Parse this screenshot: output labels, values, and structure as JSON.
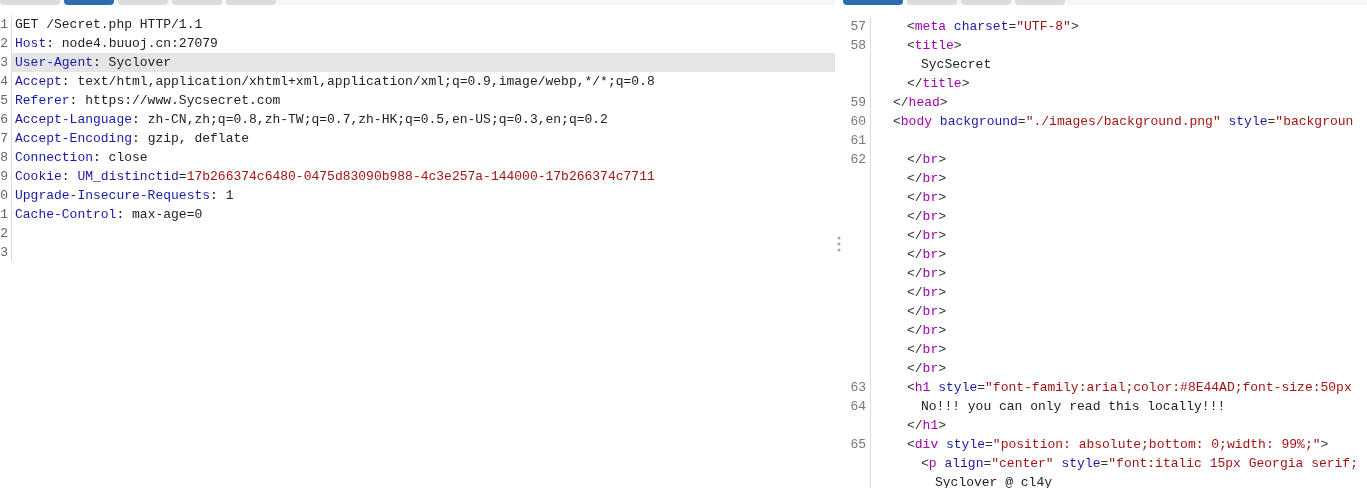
{
  "request_tabs": [
    {
      "selected": false
    },
    {
      "selected": true
    },
    {
      "selected": false
    },
    {
      "selected": false
    },
    {
      "selected": false
    }
  ],
  "response_tabs": [
    {
      "selected": true
    },
    {
      "selected": false
    },
    {
      "selected": false
    },
    {
      "selected": false
    }
  ],
  "request_lines": [
    {
      "number": "1",
      "selected": false,
      "tokens": [
        {
          "kind": "text",
          "text": "GET /Secret.php HTTP/1.1"
        }
      ]
    },
    {
      "number": "2",
      "selected": false,
      "tokens": [
        {
          "kind": "name",
          "text": "Host"
        },
        {
          "kind": "text",
          "text": ": node4.buuoj.cn:27079"
        }
      ]
    },
    {
      "number": "3",
      "selected": true,
      "tokens": [
        {
          "kind": "name",
          "text": "User-Agent"
        },
        {
          "kind": "text",
          "text": ": Syclover"
        }
      ]
    },
    {
      "number": "4",
      "selected": false,
      "tokens": [
        {
          "kind": "name",
          "text": "Accept"
        },
        {
          "kind": "text",
          "text": ": text/html,application/xhtml+xml,application/xml;q=0.9,image/webp,*/*;q=0.8"
        }
      ]
    },
    {
      "number": "5",
      "selected": false,
      "tokens": [
        {
          "kind": "name",
          "text": "Referer"
        },
        {
          "kind": "text",
          "text": ": https://www.Sycsecret.com"
        }
      ]
    },
    {
      "number": "6",
      "selected": false,
      "tokens": [
        {
          "kind": "name",
          "text": "Accept-Language"
        },
        {
          "kind": "text",
          "text": ": zh-CN,zh;q=0.8,zh-TW;q=0.7,zh-HK;q=0.5,en-US;q=0.3,en;q=0.2"
        }
      ]
    },
    {
      "number": "7",
      "selected": false,
      "tokens": [
        {
          "kind": "name",
          "text": "Accept-Encoding"
        },
        {
          "kind": "text",
          "text": ": gzip, deflate"
        }
      ]
    },
    {
      "number": "8",
      "selected": false,
      "tokens": [
        {
          "kind": "name",
          "text": "Connection"
        },
        {
          "kind": "text",
          "text": ": close"
        }
      ]
    },
    {
      "number": "9",
      "selected": false,
      "tokens": [
        {
          "kind": "name",
          "text": "Cookie"
        },
        {
          "kind": "text",
          "text": ": "
        },
        {
          "kind": "name",
          "text": "UM_distinctid"
        },
        {
          "kind": "text",
          "text": "="
        },
        {
          "kind": "value",
          "text": "17b266374c6480-0475d83090b988-4c3e257a-144000-17b266374c7711"
        }
      ]
    },
    {
      "number": "0",
      "selected": false,
      "tokens": [
        {
          "kind": "name",
          "text": "Upgrade-Insecure-Requests"
        },
        {
          "kind": "text",
          "text": ": 1"
        }
      ]
    },
    {
      "number": "1",
      "selected": false,
      "tokens": [
        {
          "kind": "name",
          "text": "Cache-Control"
        },
        {
          "kind": "text",
          "text": ": max-age=0"
        }
      ]
    },
    {
      "number": "2",
      "selected": false
    },
    {
      "number": "3",
      "selected": false
    }
  ],
  "response_lines": [
    {
      "children": [
        {
          "number": "57",
          "tokens": [
            {
              "kind": "punct",
              "text": "<"
            },
            {
              "kind": "tag",
              "text": "meta"
            },
            {
              "kind": "attr",
              "text": " charset"
            },
            {
              "kind": "punct",
              "text": "="
            },
            {
              "kind": "value",
              "text": "\"UTF-8\""
            },
            {
              "kind": "punct",
              "text": ">"
            }
          ]
        },
        {
          "number": "58",
          "tokens": [
            {
              "kind": "punct",
              "text": "<"
            },
            {
              "kind": "tag",
              "text": "title"
            },
            {
              "kind": "punct",
              "text": ">"
            }
          ],
          "children": [
            {
              "tokens": [
                {
                  "kind": "text",
                  "text": "SycSecret"
                }
              ]
            }
          ]
        },
        {
          "tokens": [
            {
              "kind": "punct",
              "text": "</"
            },
            {
              "kind": "tag",
              "text": "title"
            },
            {
              "kind": "punct",
              "text": ">"
            }
          ]
        }
      ]
    },
    {
      "number": "59",
      "tokens": [
        {
          "kind": "punct",
          "text": "</"
        },
        {
          "kind": "tag",
          "text": "head"
        },
        {
          "kind": "punct",
          "text": ">"
        }
      ]
    },
    {
      "number": "60",
      "tokens": [
        {
          "kind": "punct",
          "text": "<"
        },
        {
          "kind": "tag",
          "text": "body"
        },
        {
          "kind": "attr",
          "text": " background"
        },
        {
          "kind": "punct",
          "text": "="
        },
        {
          "kind": "value",
          "text": "\"./images/background.png\""
        },
        {
          "kind": "attr",
          "text": " style"
        },
        {
          "kind": "punct",
          "text": "="
        },
        {
          "kind": "value",
          "text": "\"backgroun"
        }
      ],
      "children": [
        {
          "number": "61"
        },
        {
          "number": "62",
          "tokens": [
            {
              "kind": "punct",
              "text": "</"
            },
            {
              "kind": "tag",
              "text": "br"
            },
            {
              "kind": "punct",
              "text": ">"
            }
          ]
        },
        {
          "tokens": [
            {
              "kind": "punct",
              "text": "</"
            },
            {
              "kind": "tag",
              "text": "br"
            },
            {
              "kind": "punct",
              "text": ">"
            }
          ]
        },
        {
          "tokens": [
            {
              "kind": "punct",
              "text": "</"
            },
            {
              "kind": "tag",
              "text": "br"
            },
            {
              "kind": "punct",
              "text": ">"
            }
          ]
        },
        {
          "tokens": [
            {
              "kind": "punct",
              "text": "</"
            },
            {
              "kind": "tag",
              "text": "br"
            },
            {
              "kind": "punct",
              "text": ">"
            }
          ]
        },
        {
          "tokens": [
            {
              "kind": "punct",
              "text": "</"
            },
            {
              "kind": "tag",
              "text": "br"
            },
            {
              "kind": "punct",
              "text": ">"
            }
          ]
        },
        {
          "tokens": [
            {
              "kind": "punct",
              "text": "</"
            },
            {
              "kind": "tag",
              "text": "br"
            },
            {
              "kind": "punct",
              "text": ">"
            }
          ]
        },
        {
          "tokens": [
            {
              "kind": "punct",
              "text": "</"
            },
            {
              "kind": "tag",
              "text": "br"
            },
            {
              "kind": "punct",
              "text": ">"
            }
          ]
        },
        {
          "tokens": [
            {
              "kind": "punct",
              "text": "</"
            },
            {
              "kind": "tag",
              "text": "br"
            },
            {
              "kind": "punct",
              "text": ">"
            }
          ]
        },
        {
          "tokens": [
            {
              "kind": "punct",
              "text": "</"
            },
            {
              "kind": "tag",
              "text": "br"
            },
            {
              "kind": "punct",
              "text": ">"
            }
          ]
        },
        {
          "tokens": [
            {
              "kind": "punct",
              "text": "</"
            },
            {
              "kind": "tag",
              "text": "br"
            },
            {
              "kind": "punct",
              "text": ">"
            }
          ]
        },
        {
          "tokens": [
            {
              "kind": "punct",
              "text": "</"
            },
            {
              "kind": "tag",
              "text": "br"
            },
            {
              "kind": "punct",
              "text": ">"
            }
          ]
        },
        {
          "tokens": [
            {
              "kind": "punct",
              "text": "</"
            },
            {
              "kind": "tag",
              "text": "br"
            },
            {
              "kind": "punct",
              "text": ">"
            }
          ]
        },
        {
          "number": "63",
          "tokens": [
            {
              "kind": "punct",
              "text": "<"
            },
            {
              "kind": "tag",
              "text": "h1"
            },
            {
              "kind": "attr",
              "text": " style"
            },
            {
              "kind": "punct",
              "text": "="
            },
            {
              "kind": "value",
              "text": "\"font-family:arial;color:#8E44AD;font-size:50px"
            }
          ],
          "children": [
            {
              "number": "64",
              "tokens": [
                {
                  "kind": "text",
                  "text": "No!!! you can only read this locally!!!"
                }
              ]
            }
          ]
        },
        {
          "tokens": [
            {
              "kind": "punct",
              "text": "</"
            },
            {
              "kind": "tag",
              "text": "h1"
            },
            {
              "kind": "punct",
              "text": ">"
            }
          ]
        },
        {
          "number": "65",
          "tokens": [
            {
              "kind": "punct",
              "text": "<"
            },
            {
              "kind": "tag",
              "text": "div"
            },
            {
              "kind": "attr",
              "text": " style"
            },
            {
              "kind": "punct",
              "text": "="
            },
            {
              "kind": "value",
              "text": "\"position: absolute;bottom: 0;width: 99%;\""
            },
            {
              "kind": "punct",
              "text": ">"
            }
          ],
          "children": [
            {
              "tokens": [
                {
                  "kind": "punct",
                  "text": "<"
                },
                {
                  "kind": "tag",
                  "text": "p"
                },
                {
                  "kind": "attr",
                  "text": " align"
                },
                {
                  "kind": "punct",
                  "text": "="
                },
                {
                  "kind": "value",
                  "text": "\"center\""
                },
                {
                  "kind": "attr",
                  "text": " style"
                },
                {
                  "kind": "punct",
                  "text": "="
                },
                {
                  "kind": "value",
                  "text": "\"font:italic 15px Georgia serif;"
                }
              ],
              "children": [
                {
                  "tokens": [
                    {
                      "kind": "text",
                      "text": "Syclover @ cl4y"
                    }
                  ]
                }
              ]
            }
          ]
        }
      ]
    }
  ]
}
